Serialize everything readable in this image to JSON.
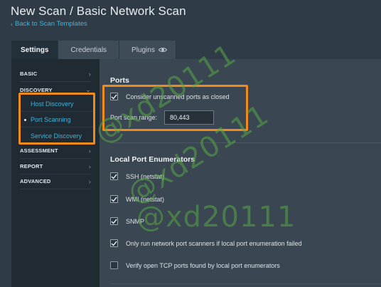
{
  "header": {
    "title": "New Scan / Basic Network Scan",
    "back_link": "Back to Scan Templates"
  },
  "tabs": [
    {
      "label": "Settings",
      "active": true
    },
    {
      "label": "Credentials",
      "active": false
    },
    {
      "label": "Plugins",
      "active": false,
      "icon": "eye-icon"
    }
  ],
  "sidebar": {
    "sections": [
      {
        "label": "BASIC",
        "expanded": false
      },
      {
        "label": "DISCOVERY",
        "expanded": true
      },
      {
        "label": "ASSESSMENT",
        "expanded": false
      },
      {
        "label": "REPORT",
        "expanded": false
      },
      {
        "label": "ADVANCED",
        "expanded": false
      }
    ],
    "discovery_items": [
      {
        "label": "Host Discovery",
        "selected": false
      },
      {
        "label": "Port Scanning",
        "selected": true
      },
      {
        "label": "Service Discovery",
        "selected": false
      }
    ]
  },
  "ports": {
    "title": "Ports",
    "consider_unscanned_closed": {
      "label": "Consider unscanned ports as closed",
      "checked": true
    },
    "range_label": "Port scan range:",
    "range_value": "80,443"
  },
  "local_enum": {
    "title": "Local Port Enumerators",
    "options": [
      {
        "label": "SSH (netstat)",
        "checked": true
      },
      {
        "label": "WMI (netstat)",
        "checked": true
      },
      {
        "label": "SNMP",
        "checked": true
      },
      {
        "label": "Only run network port scanners if local port enumeration failed",
        "checked": true
      },
      {
        "label": "Verify open TCP ports found by local port enumerators",
        "checked": false
      }
    ]
  },
  "watermark": "@xd20111",
  "colors": {
    "accent": "#44b3d9",
    "highlight": "#f08a1a",
    "watermark": "#56aa46"
  }
}
